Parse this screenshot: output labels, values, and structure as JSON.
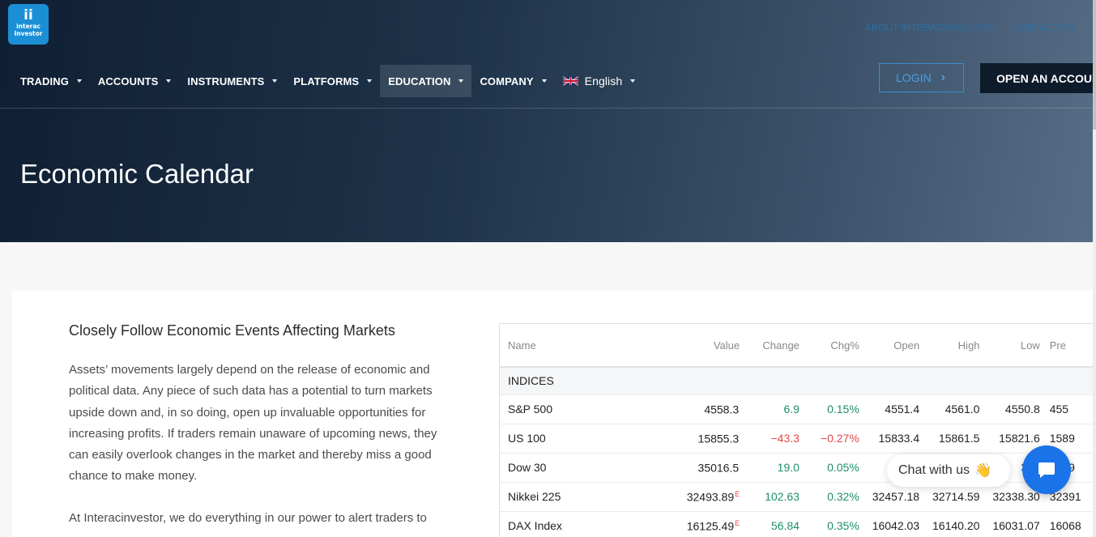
{
  "header": {
    "logo_line1": "interac",
    "logo_line2": "Investor",
    "top_link_1": "ABOUT INTERACINVESTOR",
    "top_link_2": "CONTACT US",
    "login_label": "LOGIN",
    "open_account_label": "OPEN AN ACCOUNT"
  },
  "menu": {
    "items": [
      {
        "label": "TRADING"
      },
      {
        "label": "ACCOUNTS"
      },
      {
        "label": "INSTRUMENTS"
      },
      {
        "label": "PLATFORMS"
      },
      {
        "label": "EDUCATION"
      },
      {
        "label": "COMPANY"
      }
    ],
    "language": "English"
  },
  "hero": {
    "title": "Economic Calendar"
  },
  "section": {
    "heading": "Closely Follow Economic Events Affecting Markets",
    "para1": "Assets’ movements largely depend on the release of economic and political data. Any piece of such data has a potential to turn markets upside down and, in so doing, open up invaluable opportunities for increasing profits. If traders remain unaware of upcoming news, they can easily overlook changes in the market and thereby miss a good chance to make money.",
    "para2": "At Interacinvestor, we do everything in our power to alert traders to"
  },
  "table": {
    "columns": [
      "Name",
      "Value",
      "Change",
      "Chg%",
      "Open",
      "High",
      "Low",
      "Pre"
    ],
    "group": "INDICES",
    "rows": [
      {
        "name": "S&P 500",
        "value": "4558.3",
        "sup": "",
        "change": "6.9",
        "chg_pct": "0.15%",
        "open": "4551.4",
        "high": "4561.0",
        "low": "4550.8",
        "prev": "455",
        "dir": "pos"
      },
      {
        "name": "US 100",
        "value": "15855.3",
        "sup": "",
        "change": "−43.3",
        "chg_pct": "−0.27%",
        "open": "15833.4",
        "high": "15861.5",
        "low": "15821.6",
        "prev": "1589",
        "dir": "neg"
      },
      {
        "name": "Dow 30",
        "value": "35016.5",
        "sup": "",
        "change": "19.0",
        "chg_pct": "0.05%",
        "open": "",
        "high": "",
        "low": "349",
        "prev": "3499",
        "dir": "pos"
      },
      {
        "name": "Nikkei 225",
        "value": "32493.89",
        "sup": "E",
        "change": "102.63",
        "chg_pct": "0.32%",
        "open": "32457.18",
        "high": "32714.59",
        "low": "32338.30",
        "prev": "32391",
        "dir": "pos"
      },
      {
        "name": "DAX Index",
        "value": "16125.49",
        "sup": "E",
        "change": "56.84",
        "chg_pct": "0.35%",
        "open": "16042.03",
        "high": "16140.20",
        "low": "16031.07",
        "prev": "16068",
        "dir": "pos"
      }
    ]
  },
  "chat": {
    "label": "Chat with us",
    "emoji": "👋"
  },
  "colors": {
    "accent": "#1a73e8",
    "positive": "#1e8f6a",
    "negative": "#e24b4b",
    "logo": "#1b8fd6"
  },
  "icons": {
    "login": "chevron-right-icon",
    "chat": "chat-bubble-icon",
    "flag": "uk-flag-icon"
  }
}
